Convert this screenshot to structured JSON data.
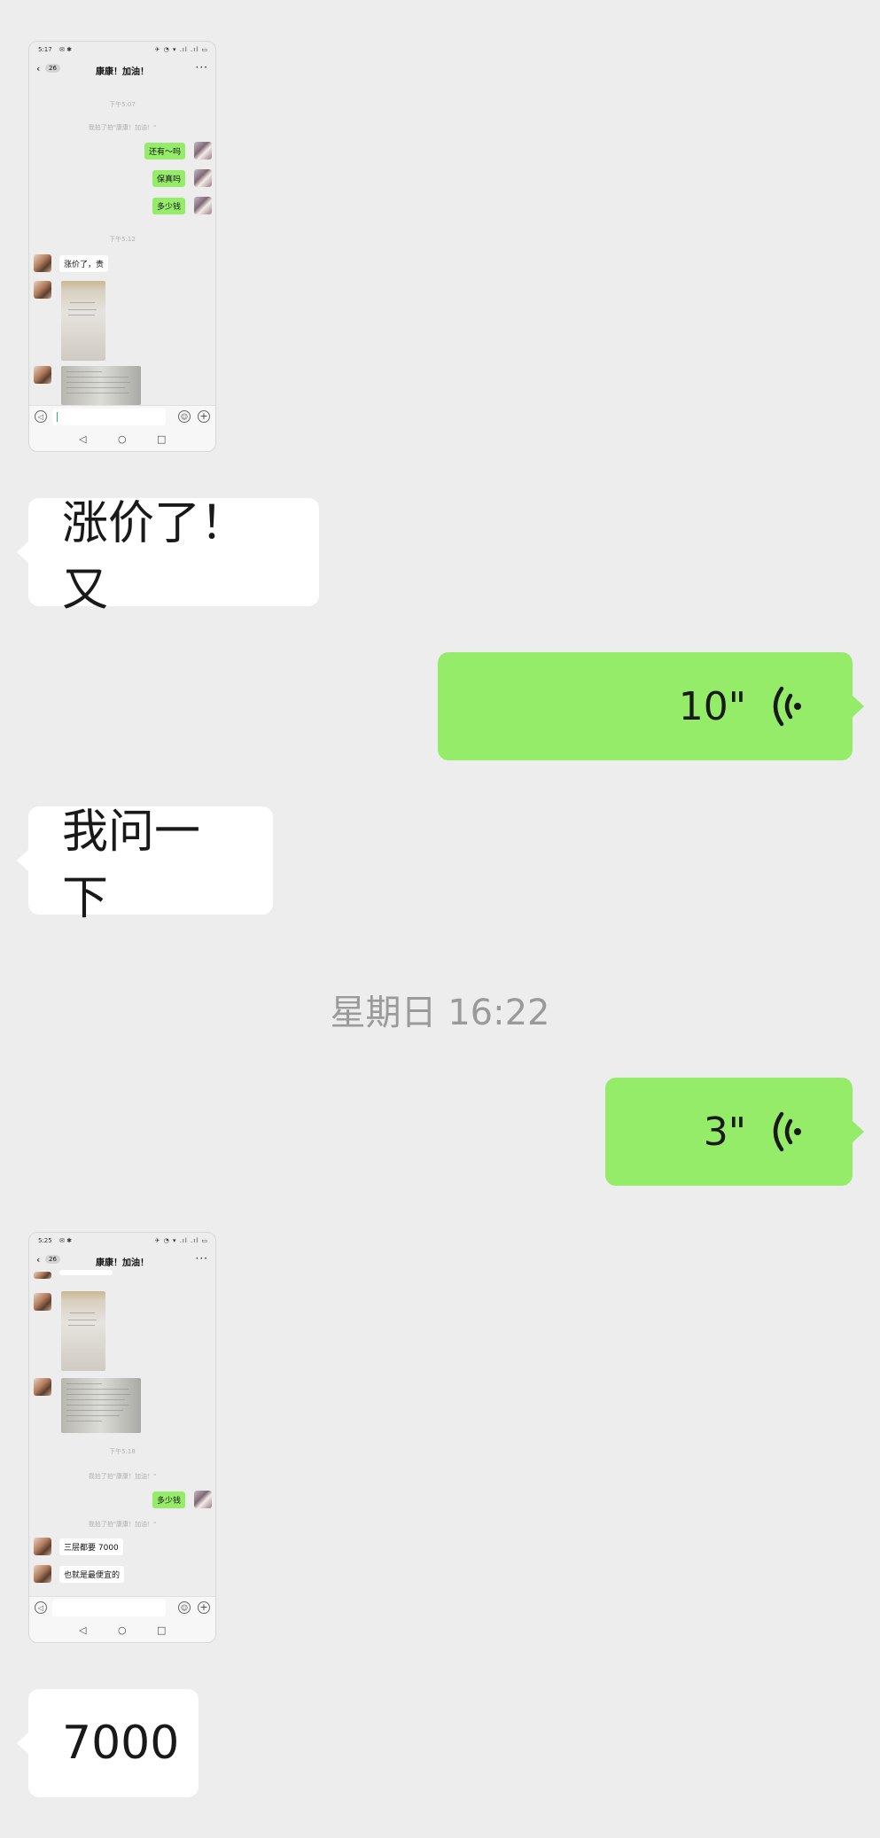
{
  "shot1": {
    "status_time": "5:17",
    "status_left_icons": "✉ ✱",
    "status_right_icons": "✈ ◔ ▾ .ıl .ıl ▭",
    "back_count": "26",
    "title": "康康！加油！",
    "more": "···",
    "time1": "下午5:07",
    "notice": "我拍了拍\"康康！加油！\"",
    "msgs_out": [
      "还有～吗",
      "保真吗",
      "多少钱"
    ],
    "time2": "下午5:12",
    "msg_in": "涨价了，贵"
  },
  "msg1": "涨价了！又",
  "voice1": {
    "duration": "10\""
  },
  "msg2": "我问一下",
  "timestamp": "星期日 16:22",
  "voice2": {
    "duration": "3\""
  },
  "shot2": {
    "status_time": "5:25",
    "status_left_icons": "✉ ✱",
    "status_right_icons": "✈ ◔ ▾ .ıl .ıl ▭",
    "back_count": "26",
    "title": "康康！加油！",
    "more": "···",
    "time1": "下午5:18",
    "notice1": "我拍了拍\"康康！加油！\"",
    "msg_out": "多少钱",
    "notice2": "我拍了拍\"康康！加油！\"",
    "msgs_in": [
      "三层都要 7000",
      "也就是最便宜的"
    ]
  },
  "msg3": "7000",
  "colors": {
    "background": "#ededed",
    "bubble_out": "#95ec69",
    "bubble_in": "#ffffff",
    "timestamp": "#9a9a9a"
  }
}
